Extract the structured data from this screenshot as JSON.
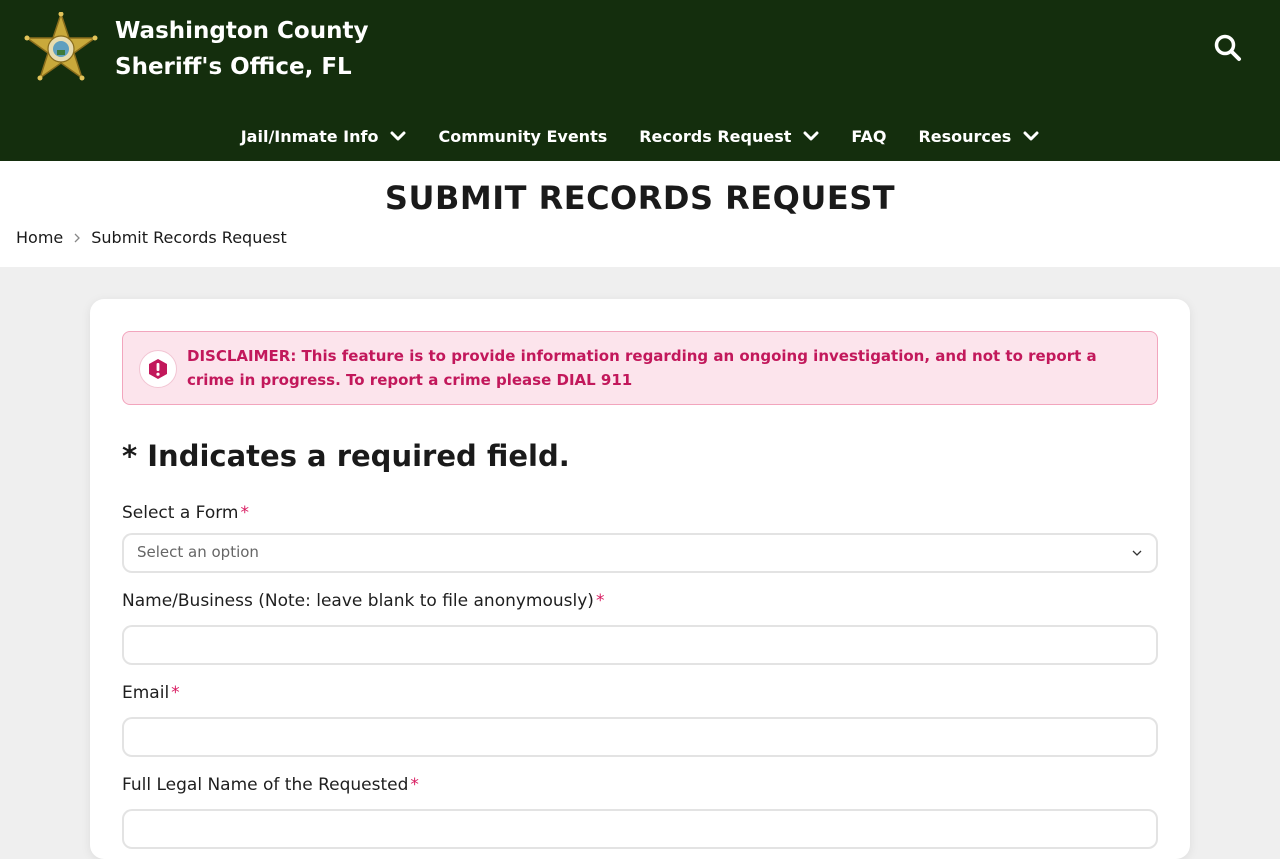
{
  "header": {
    "site_title_line1": "Washington County",
    "site_title_line2": "Sheriff's Office, FL",
    "logo_icon": "sheriff-star-badge-icon",
    "search_icon": "search-icon",
    "background_color": "#142e0d"
  },
  "nav": {
    "items": [
      {
        "label": "Jail/Inmate Info",
        "has_dropdown": true
      },
      {
        "label": "Community Events",
        "has_dropdown": false
      },
      {
        "label": "Records Request",
        "has_dropdown": true
      },
      {
        "label": "FAQ",
        "has_dropdown": false
      },
      {
        "label": "Resources",
        "has_dropdown": true
      }
    ]
  },
  "page": {
    "title": "SUBMIT RECORDS REQUEST",
    "breadcrumb": {
      "home": "Home",
      "current": "Submit Records Request"
    }
  },
  "alert": {
    "icon": "exclamation-shield-icon",
    "text": "DISCLAIMER: This feature is to provide information regarding an ongoing investigation, and not to report a crime in progress. To report a crime please DIAL 911",
    "color": "#c2185b"
  },
  "form": {
    "required_note": "* Indicates a required field.",
    "required_marker": "*",
    "fields": [
      {
        "label": "Select a Form",
        "type": "select",
        "placeholder": "Select an option",
        "value": ""
      },
      {
        "label": "Name/Business (Note: leave blank to file anonymously)",
        "type": "text",
        "value": ""
      },
      {
        "label": "Email",
        "type": "email",
        "value": ""
      },
      {
        "label": "Full Legal Name of the Requested",
        "type": "text",
        "value": ""
      }
    ]
  }
}
